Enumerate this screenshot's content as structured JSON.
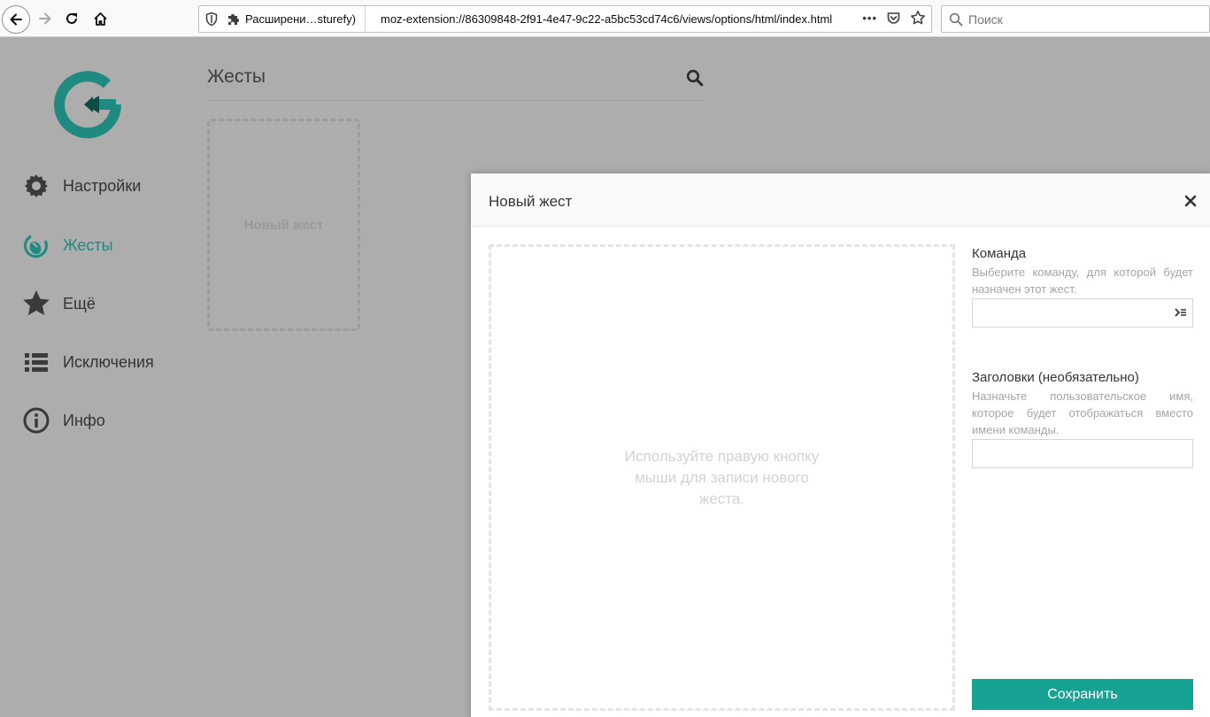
{
  "browser": {
    "tab_extension_label": "Расширени…sturefy)",
    "url": "moz-extension://86309848-2f91-4e47-9c22-a5bc53cd74c6/views/options/html/index.html",
    "search_placeholder": "Поиск",
    "page_actions_label": "•••"
  },
  "app": {
    "logo": "gesturefy-logo",
    "accent_color": "#1f8a80"
  },
  "sidebar": {
    "items": [
      {
        "label": "Настройки",
        "icon": "gear-icon",
        "active": false
      },
      {
        "label": "Жесты",
        "icon": "gesture-icon",
        "active": true
      },
      {
        "label": "Ещё",
        "icon": "star-icon",
        "active": false
      },
      {
        "label": "Исключения",
        "icon": "list-icon",
        "active": false
      },
      {
        "label": "Инфо",
        "icon": "info-icon",
        "active": false
      }
    ]
  },
  "main": {
    "title": "Жесты",
    "new_gesture_tile_label": "Новый жест"
  },
  "modal": {
    "title": "Новый жест",
    "canvas_hint": "Используйте правую кнопку мыши для записи нового жеста.",
    "command": {
      "label": "Команда",
      "description": "Выберите команду, для которой будет назначен этот жест.",
      "value": ""
    },
    "label_field": {
      "label": "Заголовки (необязательно)",
      "description": "Назначьте пользовательское имя, которое будет отображаться вместо имени команды.",
      "value": ""
    },
    "save_label": "Сохранить",
    "save_color": "#16a394"
  }
}
